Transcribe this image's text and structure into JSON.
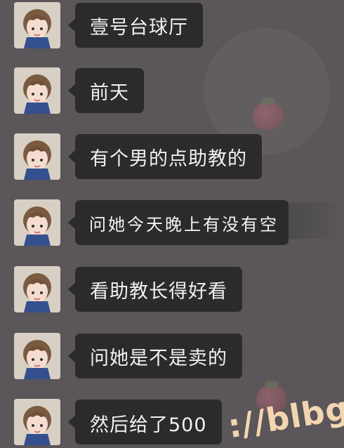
{
  "chat": {
    "messages": [
      {
        "text": "壹号台球厅"
      },
      {
        "text": "前天"
      },
      {
        "text": "有个男的点助教的"
      },
      {
        "text": "问她今天晚上有没有空"
      },
      {
        "text": "看助教长得好看"
      },
      {
        "text": "问她是不是卖的"
      },
      {
        "text": "然后给了500"
      }
    ]
  },
  "watermark": {
    "text": "://blbg"
  },
  "colors": {
    "background": "#5a5659",
    "bubble": "#2b2b2b",
    "bubble_text": "#f1f1f1"
  }
}
